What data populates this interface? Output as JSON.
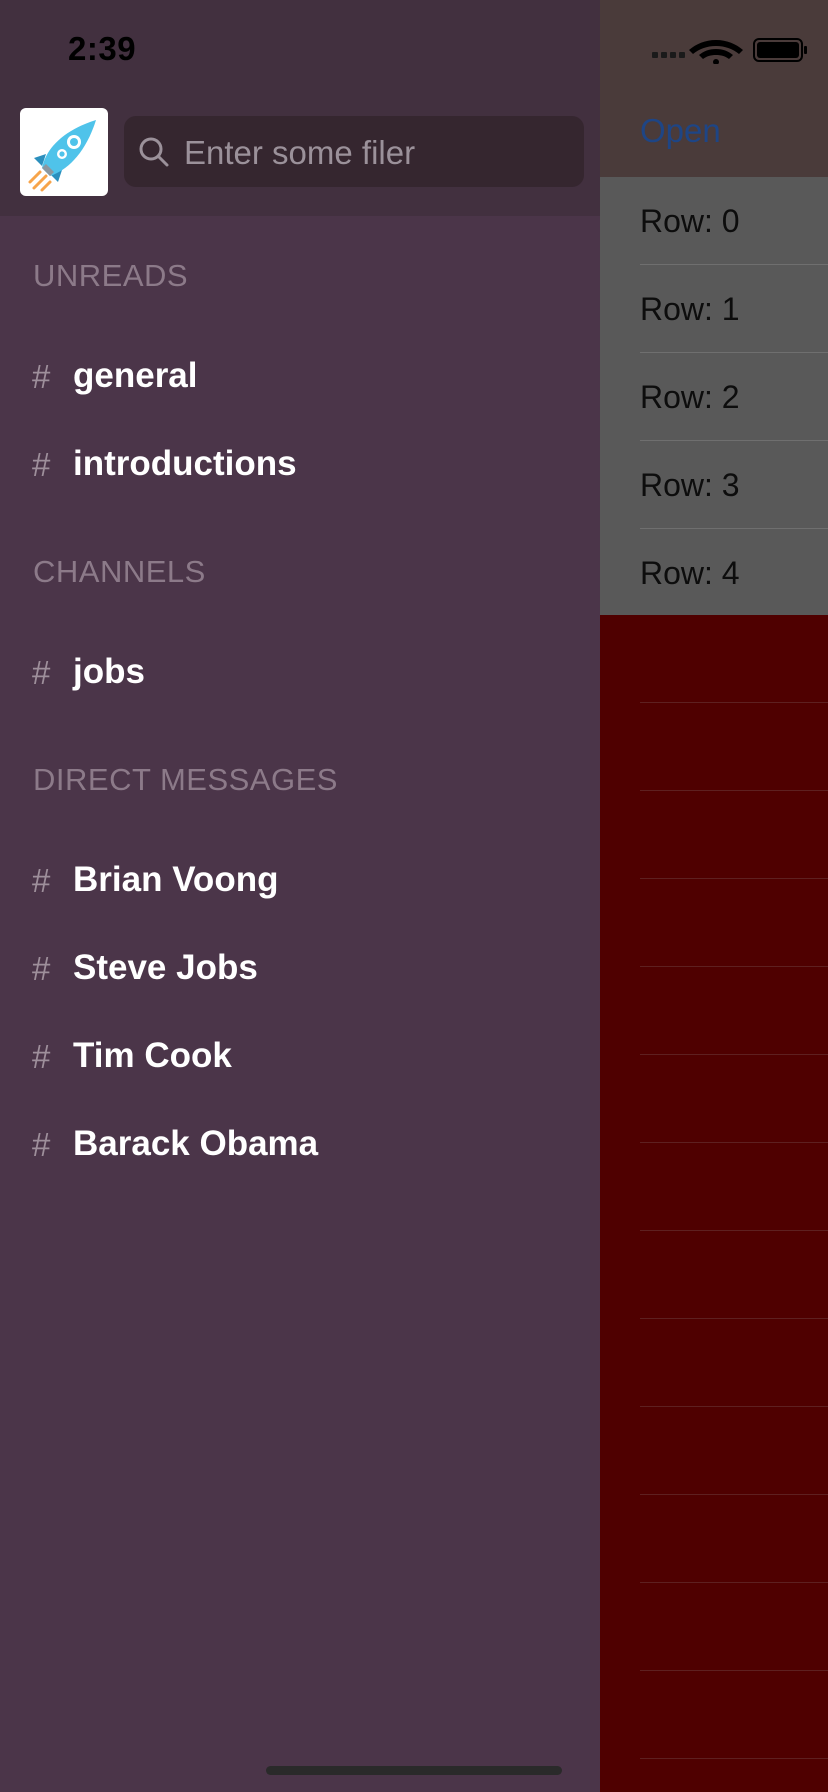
{
  "status_bar": {
    "time": "2:39"
  },
  "search": {
    "placeholder": "Enter some filer"
  },
  "sections": {
    "unreads": {
      "title": "UNREADS",
      "items": [
        "general",
        "introductions"
      ]
    },
    "channels": {
      "title": "CHANNELS",
      "items": [
        "jobs"
      ]
    },
    "direct_messages": {
      "title": "DIRECT MESSAGES",
      "items": [
        "Brian Voong",
        "Steve Jobs",
        "Tim Cook",
        "Barack Obama"
      ]
    }
  },
  "item_prefix": "#",
  "main": {
    "open_label": "Open",
    "rows": [
      "Row: 0",
      "Row: 1",
      "Row: 2",
      "Row: 3",
      "Row: 4"
    ]
  },
  "icons": [
    "search-icon",
    "app-rocket-icon",
    "signal-icon",
    "wifi-icon",
    "battery-icon"
  ],
  "colors": {
    "drawer_bg": "#4b3549",
    "drawer_header_bg": "#42303f",
    "section_title": "#8c7a89",
    "main_bg_dimmed": "#4f0000",
    "link": "#1e4585"
  }
}
